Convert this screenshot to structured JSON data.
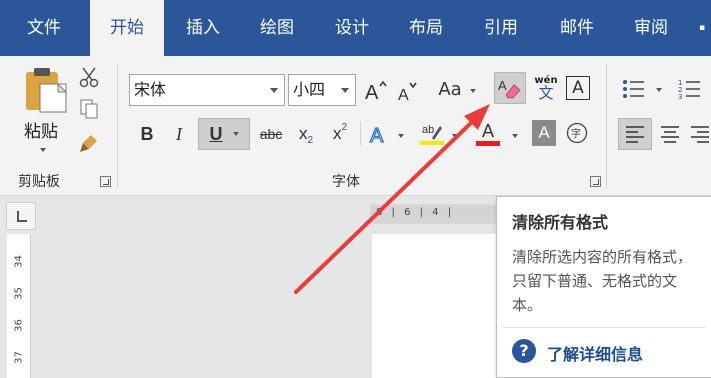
{
  "tabs": [
    {
      "label": "文件",
      "active": false
    },
    {
      "label": "开始",
      "active": true
    },
    {
      "label": "插入",
      "active": false
    },
    {
      "label": "绘图",
      "active": false
    },
    {
      "label": "设计",
      "active": false
    },
    {
      "label": "布局",
      "active": false
    },
    {
      "label": "引用",
      "active": false
    },
    {
      "label": "邮件",
      "active": false
    },
    {
      "label": "审阅",
      "active": false
    }
  ],
  "clipboard": {
    "paste_label": "粘贴",
    "group_label": "剪贴板"
  },
  "font": {
    "font_name": "宋体",
    "font_size": "小四",
    "change_case_label": "Aa",
    "phonetic_top": "wén",
    "phonetic_bottom": "文",
    "border_char": "A",
    "bold": "B",
    "italic": "I",
    "underline": "U",
    "strike": "abc",
    "subscript_base": "x",
    "subscript_mark": "2",
    "superscript_base": "x",
    "superscript_mark": "2",
    "group_label": "字体",
    "underline_color": "#e61e1e",
    "highlight_color": "#ffe600"
  },
  "ruler": {
    "horizontal_text": "8 | 6 | 4 |",
    "vertical_ticks": [
      "34",
      "35",
      "36",
      "37"
    ]
  },
  "tooltip": {
    "title": "清除所有格式",
    "description": "清除所选内容的所有格式，只留下普通、无格式的文本。",
    "link": "了解详细信息",
    "help_glyph": "?"
  },
  "colors": {
    "accent": "#2b579a",
    "arrow": "#ec3b3b"
  }
}
